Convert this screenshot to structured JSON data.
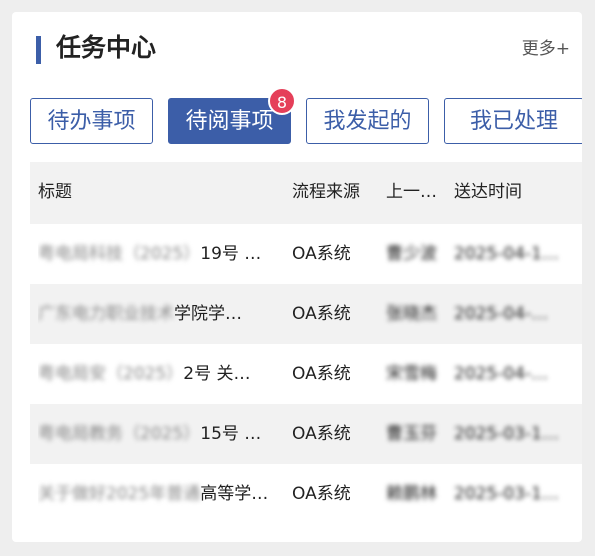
{
  "header": {
    "title": "任务中心",
    "more": "更多+"
  },
  "tabs": [
    {
      "label": "待办事项"
    },
    {
      "label": "待阅事项",
      "badge": "8"
    },
    {
      "label": "我发起的"
    },
    {
      "label": "我已处理"
    }
  ],
  "table": {
    "columns": [
      "标题",
      "流程来源",
      "上一…",
      "送达时间"
    ],
    "rows": [
      {
        "title_hidden": "粤电局科技（2025）",
        "title_visible": "19号 …",
        "source": "OA系统",
        "prev": "曹少波",
        "time": "2025-04-1…"
      },
      {
        "title_hidden": "广东电力职业技术",
        "title_visible": "学院学…",
        "source": "OA系统",
        "prev": "张晓杰",
        "time": "2025-04-…"
      },
      {
        "title_hidden": "粤电局安（2025）",
        "title_visible": "2号 关…",
        "source": "OA系统",
        "prev": "宋雪梅",
        "time": "2025-04-…"
      },
      {
        "title_hidden": "粤电局教务（2025）",
        "title_visible": "15号 …",
        "source": "OA系统",
        "prev": "曹玉芬",
        "time": "2025-03-1…"
      },
      {
        "title_hidden": "关于做好2025年普通",
        "title_visible": "高等学…",
        "source": "OA系统",
        "prev": "赖鹏林",
        "time": "2025-03-1…"
      }
    ]
  }
}
